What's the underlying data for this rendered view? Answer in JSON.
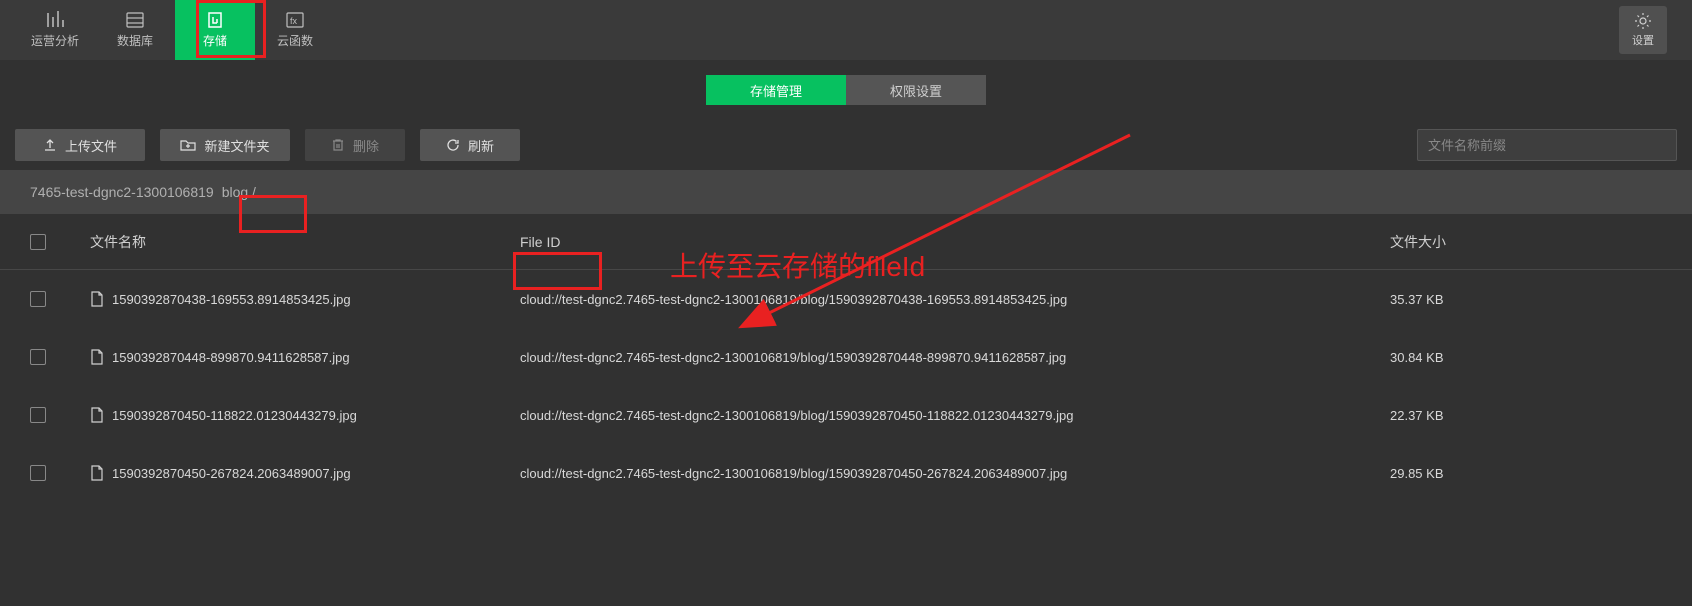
{
  "nav": {
    "tabs": [
      {
        "label": "运营分析",
        "icon": "analytics"
      },
      {
        "label": "数据库",
        "icon": "database"
      },
      {
        "label": "存储",
        "icon": "storage",
        "active": true
      },
      {
        "label": "云函数",
        "icon": "function"
      }
    ],
    "settings_label": "设置"
  },
  "sub_tabs": [
    {
      "label": "存储管理",
      "active": true
    },
    {
      "label": "权限设置"
    }
  ],
  "toolbar": {
    "upload_label": "上传文件",
    "new_folder_label": "新建文件夹",
    "delete_label": "删除",
    "refresh_label": "刷新",
    "search_placeholder": "文件名称前缀"
  },
  "breadcrumb": {
    "root": "7465-test-dgnc2-1300106819",
    "path": "blog /"
  },
  "table": {
    "headers": {
      "filename": "文件名称",
      "fileid": "File ID",
      "filesize": "文件大小"
    },
    "rows": [
      {
        "filename": "1590392870438-169553.8914853425.jpg",
        "fileid": "cloud://test-dgnc2.7465-test-dgnc2-1300106819/blog/1590392870438-169553.8914853425.jpg",
        "filesize": "35.37 KB"
      },
      {
        "filename": "1590392870448-899870.9411628587.jpg",
        "fileid": "cloud://test-dgnc2.7465-test-dgnc2-1300106819/blog/1590392870448-899870.9411628587.jpg",
        "filesize": "30.84 KB"
      },
      {
        "filename": "1590392870450-118822.01230443279.jpg",
        "fileid": "cloud://test-dgnc2.7465-test-dgnc2-1300106819/blog/1590392870450-118822.01230443279.jpg",
        "filesize": "22.37 KB"
      },
      {
        "filename": "1590392870450-267824.2063489007.jpg",
        "fileid": "cloud://test-dgnc2.7465-test-dgnc2-1300106819/blog/1590392870450-267824.2063489007.jpg",
        "filesize": "29.85 KB"
      }
    ]
  },
  "annotation_text": "上传至云存储的fileId"
}
